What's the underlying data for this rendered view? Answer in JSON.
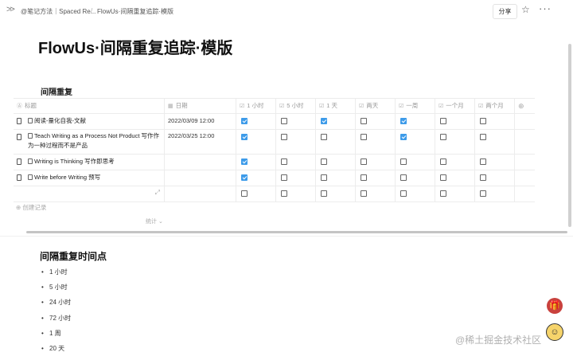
{
  "breadcrumb": {
    "parent": "@笔记方法｜Spaced Re...",
    "separator": "/",
    "current": "FlowUs·间隔重复追踪·模版"
  },
  "topbar": {
    "share_label": "分享"
  },
  "page": {
    "title": "FlowUs·间隔重复追踪·模版"
  },
  "database": {
    "title": "间隔重复",
    "columns": {
      "name": "标题",
      "date": "日期",
      "intervals": [
        "1 小时",
        "5 小时",
        "1 天",
        "两天",
        "一周",
        "一个月",
        "两个月"
      ]
    },
    "rows": [
      {
        "name": "阅读-量化自我-文献",
        "date": "2022/03/09 12:00",
        "checks": [
          true,
          false,
          true,
          false,
          true,
          false,
          false
        ]
      },
      {
        "name": "Teach Writing as a Process Not Product 写作作为一种过程而不是产品",
        "date": "2022/03/25 12:00",
        "checks": [
          true,
          false,
          false,
          false,
          true,
          false,
          false
        ]
      },
      {
        "name": "Writing is Thinking 写作即思考",
        "date": "",
        "checks": [
          true,
          false,
          false,
          false,
          false,
          false,
          false
        ]
      },
      {
        "name": "Write before Writing 预写",
        "date": "",
        "checks": [
          true,
          false,
          false,
          false,
          false,
          false,
          false
        ]
      },
      {
        "name": "",
        "date": "",
        "checks": [
          false,
          false,
          false,
          false,
          false,
          false,
          false
        ]
      }
    ],
    "add_record_label": "创建记录",
    "stats_label": "统计"
  },
  "section": {
    "heading": "间隔重复时间点",
    "items": [
      "1 小时",
      "5 小时",
      "24 小时",
      "72 小时",
      "1 周",
      "20 天"
    ]
  },
  "watermark": "@稀土掘金技术社区",
  "colors": {
    "checkbox_checked": "#3d9be9",
    "gift_button": "#c9413d"
  }
}
